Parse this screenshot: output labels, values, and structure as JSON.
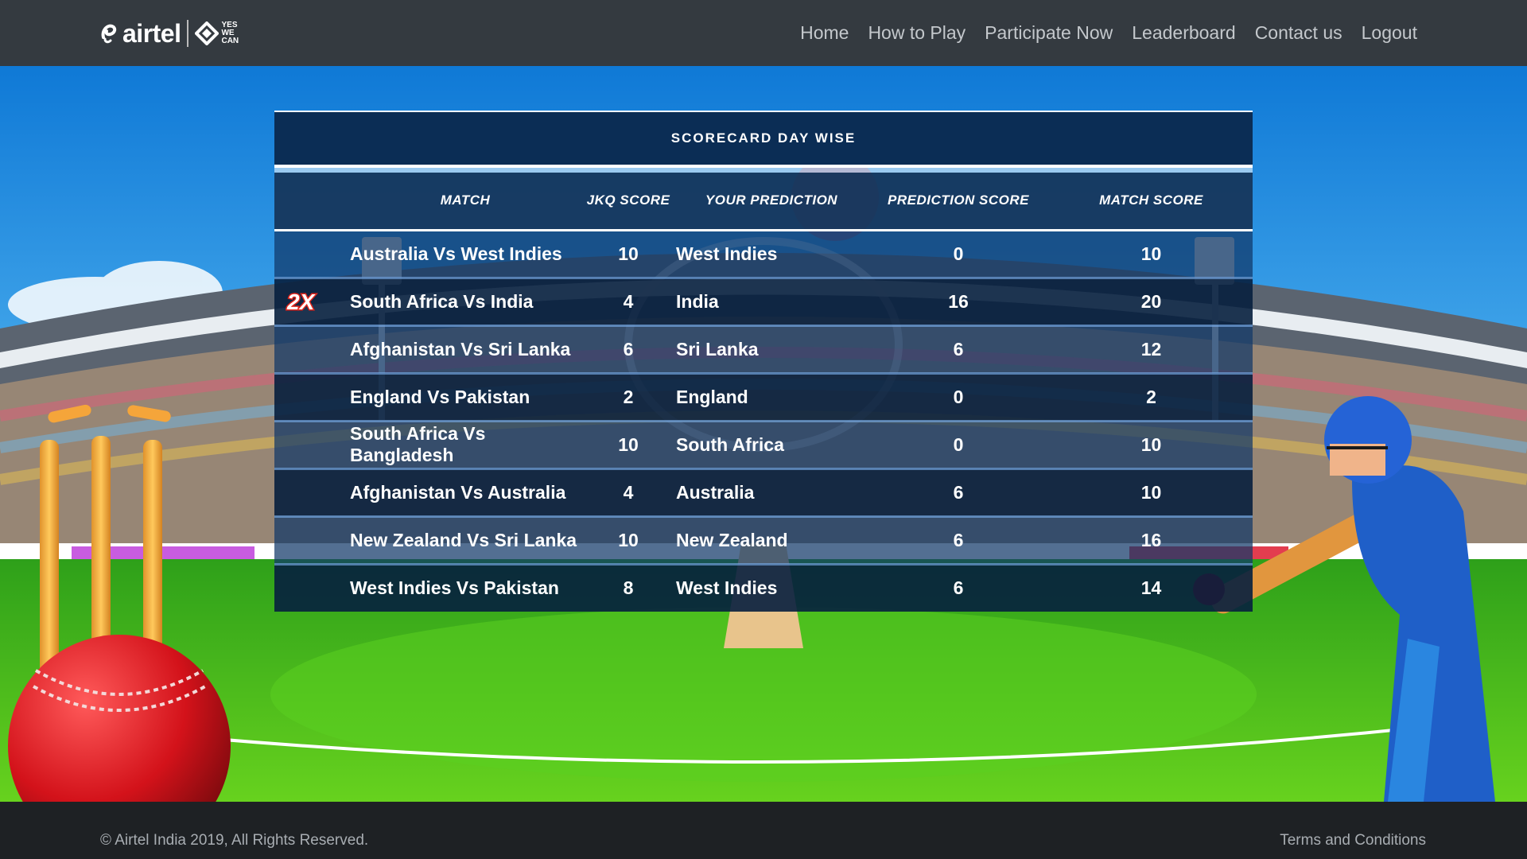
{
  "brand": {
    "name": "airtel",
    "tagline": [
      "YES",
      "WE",
      "CAN"
    ],
    "logo_icon": "airtel-swirl-icon",
    "badge_icon": "yes-we-can-badge-icon"
  },
  "nav": {
    "items": [
      {
        "label": "Home"
      },
      {
        "label": "How to Play"
      },
      {
        "label": "Participate Now"
      },
      {
        "label": "Leaderboard"
      },
      {
        "label": "Contact us"
      },
      {
        "label": "Logout"
      }
    ]
  },
  "scorecard": {
    "title": "SCORECARD DAY WISE",
    "columns": [
      "MATCH",
      "JKQ SCORE",
      "YOUR PREDICTION",
      "PREDICTION SCORE",
      "MATCH SCORE"
    ],
    "rows": [
      {
        "badge": "",
        "match": "Australia Vs West Indies",
        "jkq": "10",
        "prediction": "West Indies",
        "prediction_score": "0",
        "match_score": "10"
      },
      {
        "badge": "2X",
        "match": "South Africa Vs India",
        "jkq": "4",
        "prediction": "India",
        "prediction_score": "16",
        "match_score": "20"
      },
      {
        "badge": "",
        "match": "Afghanistan Vs Sri Lanka",
        "jkq": "6",
        "prediction": "Sri Lanka",
        "prediction_score": "6",
        "match_score": "12"
      },
      {
        "badge": "",
        "match": "England Vs Pakistan",
        "jkq": "2",
        "prediction": "England",
        "prediction_score": "0",
        "match_score": "2"
      },
      {
        "badge": "",
        "match": "South Africa Vs Bangladesh",
        "jkq": "10",
        "prediction": "South Africa",
        "prediction_score": "0",
        "match_score": "10"
      },
      {
        "badge": "",
        "match": "Afghanistan Vs Australia",
        "jkq": "4",
        "prediction": "Australia",
        "prediction_score": "6",
        "match_score": "10"
      },
      {
        "badge": "",
        "match": "New Zealand Vs Sri Lanka",
        "jkq": "10",
        "prediction": "New Zealand",
        "prediction_score": "6",
        "match_score": "16"
      },
      {
        "badge": "",
        "match": "West Indies Vs Pakistan",
        "jkq": "8",
        "prediction": "West Indies",
        "prediction_score": "6",
        "match_score": "14"
      }
    ]
  },
  "footer": {
    "copyright": "© Airtel India 2019, All Rights Reserved.",
    "terms": "Terms and Conditions"
  },
  "colors": {
    "navbar": "#343a40",
    "footer": "#1e2124",
    "card_header": "#0b2d55",
    "badge_red": "#e1251b",
    "sky": "#1e8fe0",
    "pitch": "#4cc21e"
  }
}
